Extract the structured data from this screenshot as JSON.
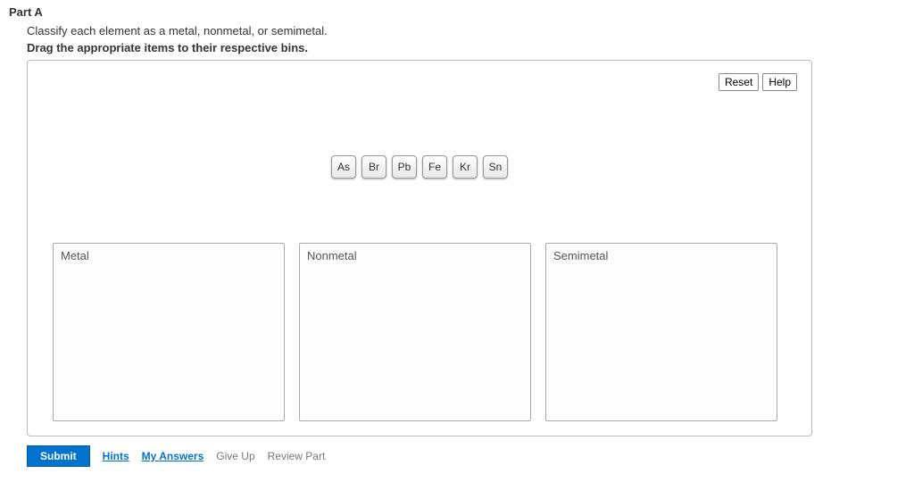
{
  "part_label": "Part A",
  "instruction_text": "Classify each element as a metal, nonmetal, or semimetal.",
  "drag_instruction": "Drag the appropriate items to their respective bins.",
  "buttons": {
    "reset": "Reset",
    "help": "Help",
    "submit": "Submit"
  },
  "tiles": [
    "As",
    "Br",
    "Pb",
    "Fe",
    "Kr",
    "Sn"
  ],
  "bins": [
    "Metal",
    "Nonmetal",
    "Semimetal"
  ],
  "bottom_links": {
    "hints": "Hints",
    "my_answers": "My Answers",
    "give_up": "Give Up",
    "review_part": "Review Part"
  }
}
